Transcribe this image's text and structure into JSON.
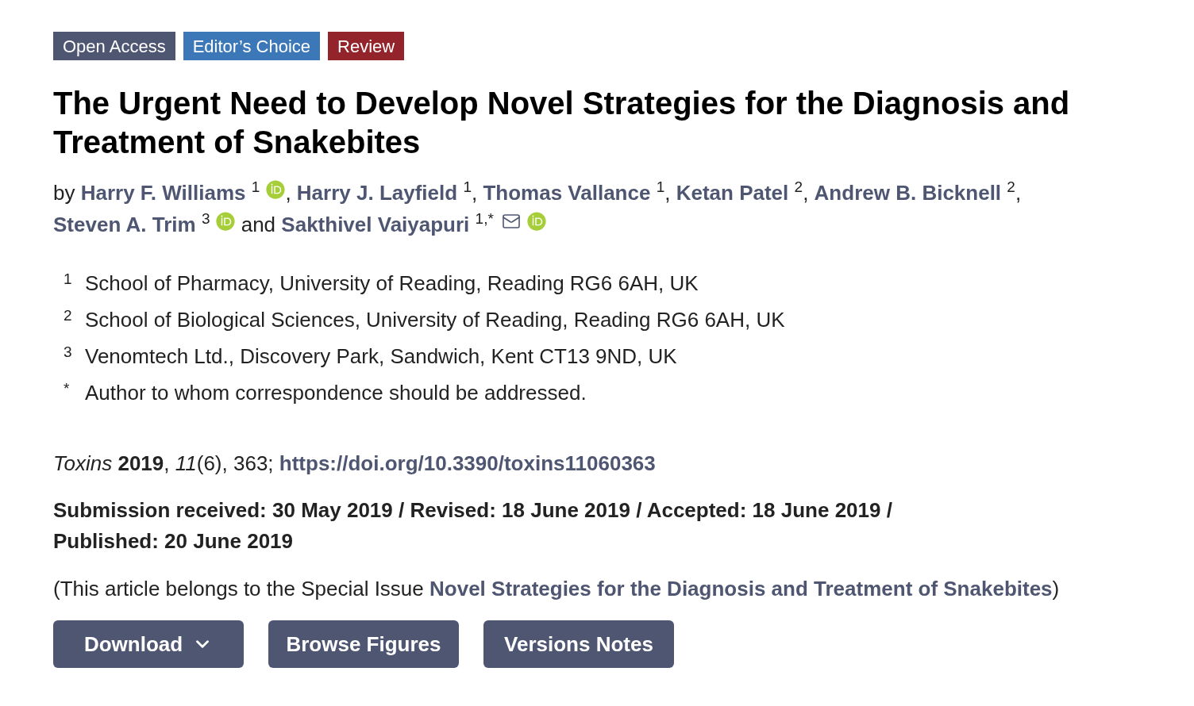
{
  "badges": [
    {
      "label": "Open Access",
      "color": "#4f5671"
    },
    {
      "label": "Editor’s Choice",
      "color": "#3c78b7"
    },
    {
      "label": "Review",
      "color": "#93242b"
    }
  ],
  "title": "The Urgent Need to Develop Novel Strategies for the Diagnosis and Treatment of Snakebites",
  "byline": {
    "prefix": "by",
    "authors": [
      {
        "name": "Harry F. Williams",
        "affiliation": "1",
        "orcid": true,
        "email": false,
        "separator": {
          "kind": "comma",
          "text": ","
        }
      },
      {
        "name": "Harry J. Layfield",
        "affiliation": "1",
        "orcid": false,
        "email": false,
        "separator": {
          "kind": "comma",
          "text": ","
        }
      },
      {
        "name": "Thomas Vallance",
        "affiliation": "1",
        "orcid": false,
        "email": false,
        "separator": {
          "kind": "comma",
          "text": ","
        }
      },
      {
        "name": "Ketan Patel",
        "affiliation": "2",
        "orcid": false,
        "email": false,
        "separator": {
          "kind": "comma",
          "text": ","
        }
      },
      {
        "name": "Andrew B. Bicknell",
        "affiliation": "2",
        "orcid": false,
        "email": false,
        "separator": {
          "kind": "comma",
          "text": ","
        }
      },
      {
        "name": "Steven A. Trim",
        "affiliation": "3",
        "orcid": true,
        "email": false,
        "separator": {
          "kind": "word",
          "text": "and"
        }
      },
      {
        "name": "Sakthivel Vaiyapuri",
        "affiliation": "1,*",
        "orcid": true,
        "email": true
      }
    ]
  },
  "affiliations": [
    {
      "marker": "1",
      "text": "School of Pharmacy, University of Reading, Reading RG6 6AH, UK"
    },
    {
      "marker": "2",
      "text": "School of Biological Sciences, University of Reading, Reading RG6 6AH, UK"
    },
    {
      "marker": "3",
      "text": "Venomtech Ltd., Discovery Park, Sandwich, Kent CT13 9ND, UK"
    },
    {
      "marker": "*",
      "text": "Author to whom correspondence should be addressed."
    }
  ],
  "citation": {
    "text": "*Toxins* **2019**, *11*(6), 363;",
    "doi": "https://doi.org/10.3390/toxins11060363"
  },
  "dates": [
    "Submission received: 30 May 2019 /",
    "Revised: 18 June 2019 /",
    "Accepted: 18 June 2019 /",
    "Published: 20 June 2019"
  ],
  "special_issue": {
    "prefix": "(This article belongs to the Special Issue",
    "link": "Novel Strategies for the Diagnosis and Treatment of Snakebites",
    "suffix": ")"
  },
  "buttons": [
    {
      "label": "Download",
      "caret": true
    },
    {
      "label": "Browse Figures",
      "caret": false
    },
    {
      "label": "Versions Notes",
      "caret": false
    }
  ]
}
